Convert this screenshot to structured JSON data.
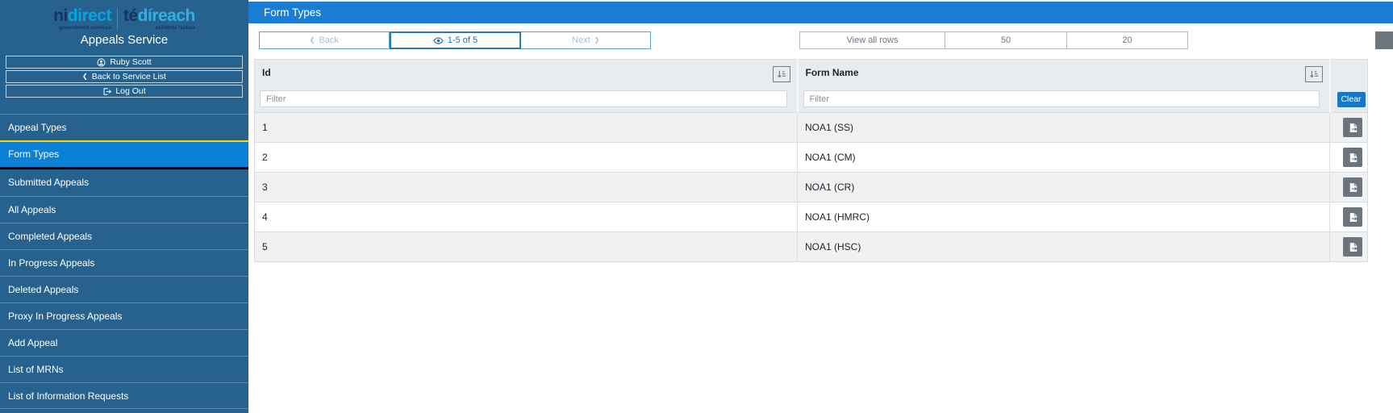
{
  "logo": {
    "ni": "ni",
    "direct": "direct",
    "tagline_en": "government services",
    "te": "té",
    "direach": "díreach",
    "tagline_ga": "seirbhísí rialtais"
  },
  "sidebar": {
    "title": "Appeals Service",
    "buttons": [
      {
        "label": "Ruby Scott",
        "icon": "user-icon"
      },
      {
        "label": "Back to Service List",
        "icon": "chevron-left-icon"
      },
      {
        "label": "Log Out",
        "icon": "logout-icon"
      }
    ],
    "items": [
      {
        "label": "Appeal Types",
        "active": false
      },
      {
        "label": "Form Types",
        "active": true
      },
      {
        "label": "Submitted Appeals",
        "active": false
      },
      {
        "label": "All Appeals",
        "active": false
      },
      {
        "label": "Completed Appeals",
        "active": false
      },
      {
        "label": "In Progress Appeals",
        "active": false
      },
      {
        "label": "Deleted Appeals",
        "active": false
      },
      {
        "label": "Proxy In Progress Appeals",
        "active": false
      },
      {
        "label": "Add Appeal",
        "active": false
      },
      {
        "label": "List of MRNs",
        "active": false
      },
      {
        "label": "List of Information Requests",
        "active": false
      }
    ]
  },
  "header": {
    "title": "Form Types"
  },
  "pager": {
    "back_label": "Back",
    "status_label": "1-5 of 5",
    "next_label": "Next",
    "view_all_label": "View all rows",
    "page_size_50": "50",
    "page_size_20": "20"
  },
  "table": {
    "columns": [
      {
        "label": "Id"
      },
      {
        "label": "Form Name"
      }
    ],
    "filter_placeholder": "Filter",
    "clear_label": "Clear",
    "rows": [
      {
        "id": "1",
        "form_name": "NOA1 (SS)"
      },
      {
        "id": "2",
        "form_name": "NOA1 (CM)"
      },
      {
        "id": "3",
        "form_name": "NOA1 (CR)"
      },
      {
        "id": "4",
        "form_name": "NOA1 (HMRC)"
      },
      {
        "id": "5",
        "form_name": "NOA1 (HSC)"
      }
    ]
  },
  "colors": {
    "sidebar_bg": "#27628f",
    "active_item_bg": "#0c80d5",
    "accent_yellow": "#ffd600",
    "topbar_bg": "#1a7dd3",
    "link_blue": "#1b6fc0",
    "muted_blue": "#99c2e6",
    "gray_button": "#6c757d",
    "clear_button_bg": "#1877c5",
    "logo_light_blue": "#00a7e0"
  }
}
